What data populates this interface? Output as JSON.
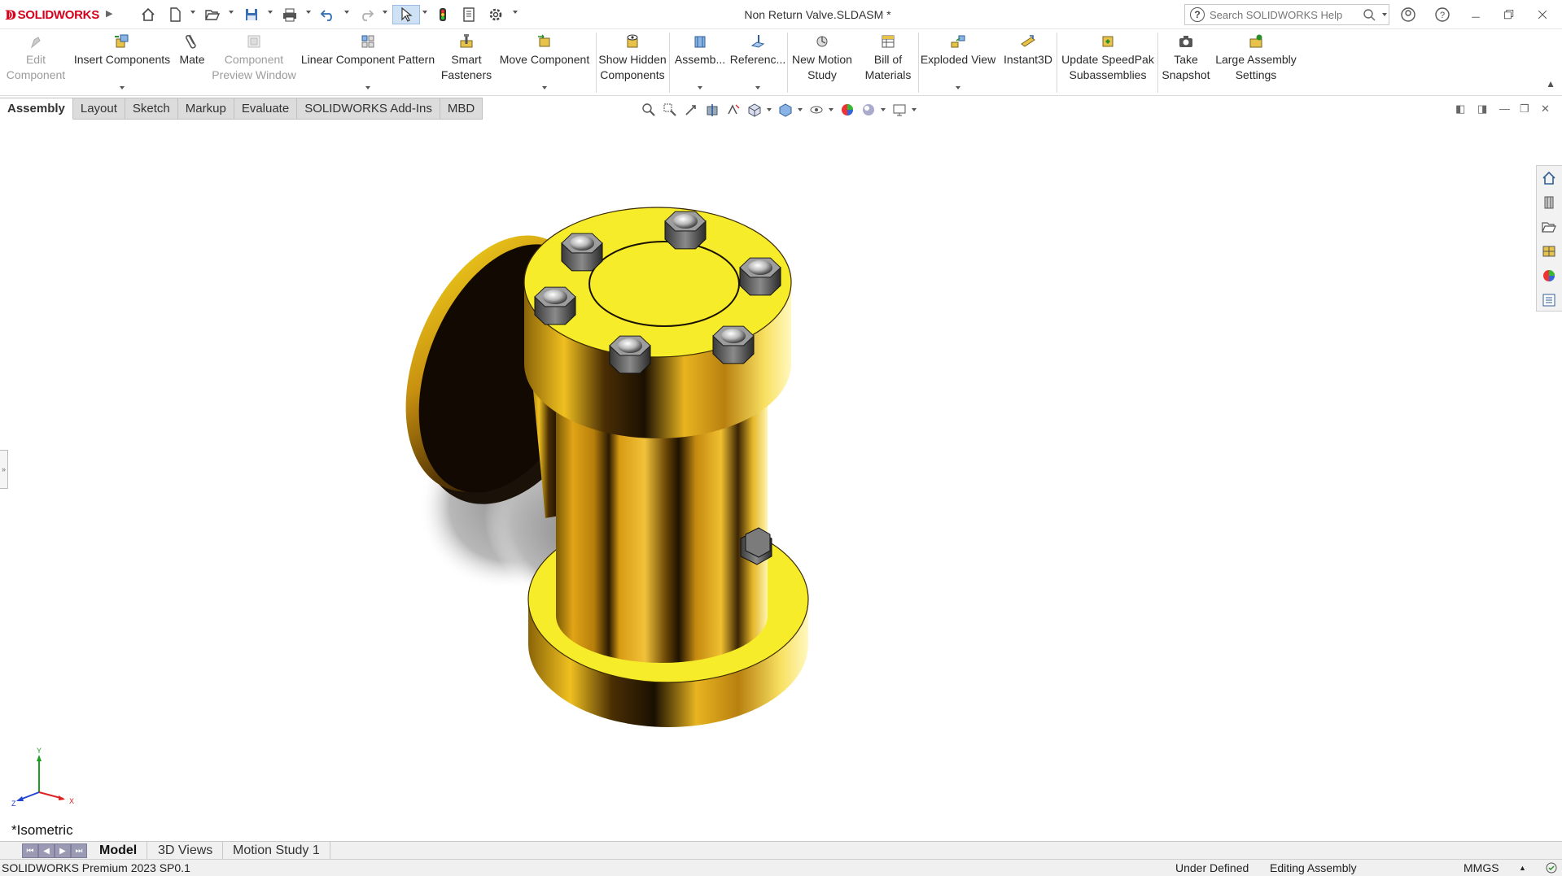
{
  "app": {
    "brand": "SOLIDWORKS",
    "brand_prefix": "3DS",
    "doc_title": "Non Return Valve.SLDASM *",
    "search_placeholder": "Search SOLIDWORKS Help"
  },
  "quick_access": [
    "home-icon",
    "new-document-icon",
    "open-icon",
    "save-icon",
    "print-icon",
    "undo-icon",
    "redo-icon",
    "select-icon",
    "rebuild-icon",
    "file-properties-icon",
    "options-icon"
  ],
  "window_controls": [
    "account-icon",
    "help-icon",
    "minimize-icon",
    "restore-icon",
    "close-icon"
  ],
  "ribbon": {
    "edit_component": [
      "Edit",
      "Component"
    ],
    "insert_components": [
      "Insert Components"
    ],
    "mate": [
      "Mate"
    ],
    "component_preview": [
      "Component",
      "Preview Window"
    ],
    "linear_pattern": [
      "Linear Component Pattern"
    ],
    "smart_fasteners": [
      "Smart",
      "Fasteners"
    ],
    "move_component": [
      "Move Component"
    ],
    "show_hidden": [
      "Show Hidden",
      "Components"
    ],
    "assembly": [
      "Assemb..."
    ],
    "reference": [
      "Referenc..."
    ],
    "new_motion": [
      "New Motion",
      "Study"
    ],
    "bom": [
      "Bill of",
      "Materials"
    ],
    "exploded_view": [
      "Exploded View"
    ],
    "instant3d": [
      "Instant3D"
    ],
    "speedpak": [
      "Update SpeedPak",
      "Subassemblies"
    ],
    "snapshot": [
      "Take",
      "Snapshot"
    ],
    "large_assembly": [
      "Large Assembly",
      "Settings"
    ]
  },
  "command_tabs": [
    "Assembly",
    "Layout",
    "Sketch",
    "Markup",
    "Evaluate",
    "SOLIDWORKS Add-Ins",
    "MBD"
  ],
  "active_command_tab": "Assembly",
  "view": {
    "name": "*Isometric",
    "axis_x": "X",
    "axis_y": "Y",
    "axis_z": "Z",
    "model_color": "#f5ea1e"
  },
  "bottom_tabs": [
    "Model",
    "3D Views",
    "Motion Study 1"
  ],
  "status": {
    "product": "SOLIDWORKS Premium 2023 SP0.1",
    "definition": "Under Defined",
    "mode": "Editing Assembly",
    "units": "MMGS",
    "units_arrow": "▲"
  }
}
